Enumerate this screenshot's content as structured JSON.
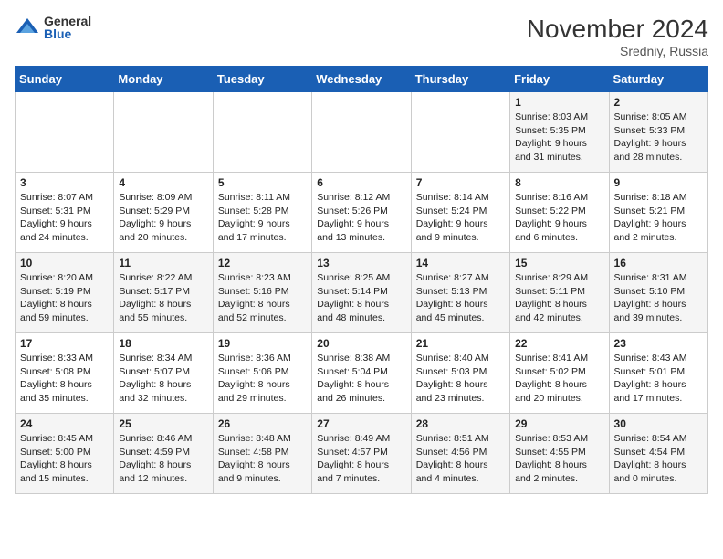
{
  "logo": {
    "general": "General",
    "blue": "Blue"
  },
  "title": "November 2024",
  "location": "Sredniy, Russia",
  "days_of_week": [
    "Sunday",
    "Monday",
    "Tuesday",
    "Wednesday",
    "Thursday",
    "Friday",
    "Saturday"
  ],
  "weeks": [
    [
      {
        "day": "",
        "info": ""
      },
      {
        "day": "",
        "info": ""
      },
      {
        "day": "",
        "info": ""
      },
      {
        "day": "",
        "info": ""
      },
      {
        "day": "",
        "info": ""
      },
      {
        "day": "1",
        "info": "Sunrise: 8:03 AM\nSunset: 5:35 PM\nDaylight: 9 hours\nand 31 minutes."
      },
      {
        "day": "2",
        "info": "Sunrise: 8:05 AM\nSunset: 5:33 PM\nDaylight: 9 hours\nand 28 minutes."
      }
    ],
    [
      {
        "day": "3",
        "info": "Sunrise: 8:07 AM\nSunset: 5:31 PM\nDaylight: 9 hours\nand 24 minutes."
      },
      {
        "day": "4",
        "info": "Sunrise: 8:09 AM\nSunset: 5:29 PM\nDaylight: 9 hours\nand 20 minutes."
      },
      {
        "day": "5",
        "info": "Sunrise: 8:11 AM\nSunset: 5:28 PM\nDaylight: 9 hours\nand 17 minutes."
      },
      {
        "day": "6",
        "info": "Sunrise: 8:12 AM\nSunset: 5:26 PM\nDaylight: 9 hours\nand 13 minutes."
      },
      {
        "day": "7",
        "info": "Sunrise: 8:14 AM\nSunset: 5:24 PM\nDaylight: 9 hours\nand 9 minutes."
      },
      {
        "day": "8",
        "info": "Sunrise: 8:16 AM\nSunset: 5:22 PM\nDaylight: 9 hours\nand 6 minutes."
      },
      {
        "day": "9",
        "info": "Sunrise: 8:18 AM\nSunset: 5:21 PM\nDaylight: 9 hours\nand 2 minutes."
      }
    ],
    [
      {
        "day": "10",
        "info": "Sunrise: 8:20 AM\nSunset: 5:19 PM\nDaylight: 8 hours\nand 59 minutes."
      },
      {
        "day": "11",
        "info": "Sunrise: 8:22 AM\nSunset: 5:17 PM\nDaylight: 8 hours\nand 55 minutes."
      },
      {
        "day": "12",
        "info": "Sunrise: 8:23 AM\nSunset: 5:16 PM\nDaylight: 8 hours\nand 52 minutes."
      },
      {
        "day": "13",
        "info": "Sunrise: 8:25 AM\nSunset: 5:14 PM\nDaylight: 8 hours\nand 48 minutes."
      },
      {
        "day": "14",
        "info": "Sunrise: 8:27 AM\nSunset: 5:13 PM\nDaylight: 8 hours\nand 45 minutes."
      },
      {
        "day": "15",
        "info": "Sunrise: 8:29 AM\nSunset: 5:11 PM\nDaylight: 8 hours\nand 42 minutes."
      },
      {
        "day": "16",
        "info": "Sunrise: 8:31 AM\nSunset: 5:10 PM\nDaylight: 8 hours\nand 39 minutes."
      }
    ],
    [
      {
        "day": "17",
        "info": "Sunrise: 8:33 AM\nSunset: 5:08 PM\nDaylight: 8 hours\nand 35 minutes."
      },
      {
        "day": "18",
        "info": "Sunrise: 8:34 AM\nSunset: 5:07 PM\nDaylight: 8 hours\nand 32 minutes."
      },
      {
        "day": "19",
        "info": "Sunrise: 8:36 AM\nSunset: 5:06 PM\nDaylight: 8 hours\nand 29 minutes."
      },
      {
        "day": "20",
        "info": "Sunrise: 8:38 AM\nSunset: 5:04 PM\nDaylight: 8 hours\nand 26 minutes."
      },
      {
        "day": "21",
        "info": "Sunrise: 8:40 AM\nSunset: 5:03 PM\nDaylight: 8 hours\nand 23 minutes."
      },
      {
        "day": "22",
        "info": "Sunrise: 8:41 AM\nSunset: 5:02 PM\nDaylight: 8 hours\nand 20 minutes."
      },
      {
        "day": "23",
        "info": "Sunrise: 8:43 AM\nSunset: 5:01 PM\nDaylight: 8 hours\nand 17 minutes."
      }
    ],
    [
      {
        "day": "24",
        "info": "Sunrise: 8:45 AM\nSunset: 5:00 PM\nDaylight: 8 hours\nand 15 minutes."
      },
      {
        "day": "25",
        "info": "Sunrise: 8:46 AM\nSunset: 4:59 PM\nDaylight: 8 hours\nand 12 minutes."
      },
      {
        "day": "26",
        "info": "Sunrise: 8:48 AM\nSunset: 4:58 PM\nDaylight: 8 hours\nand 9 minutes."
      },
      {
        "day": "27",
        "info": "Sunrise: 8:49 AM\nSunset: 4:57 PM\nDaylight: 8 hours\nand 7 minutes."
      },
      {
        "day": "28",
        "info": "Sunrise: 8:51 AM\nSunset: 4:56 PM\nDaylight: 8 hours\nand 4 minutes."
      },
      {
        "day": "29",
        "info": "Sunrise: 8:53 AM\nSunset: 4:55 PM\nDaylight: 8 hours\nand 2 minutes."
      },
      {
        "day": "30",
        "info": "Sunrise: 8:54 AM\nSunset: 4:54 PM\nDaylight: 8 hours\nand 0 minutes."
      }
    ]
  ]
}
